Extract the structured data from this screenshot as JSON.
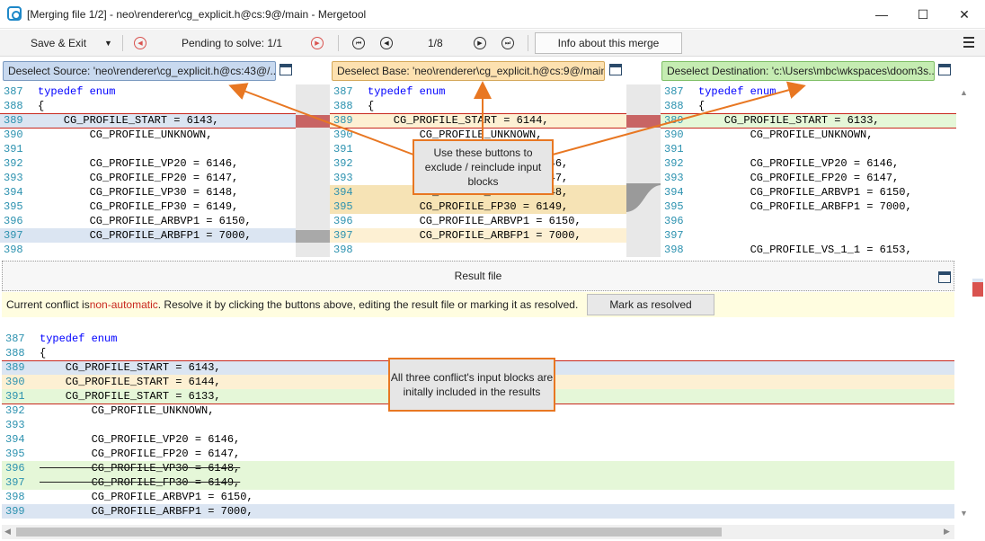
{
  "window": {
    "title": "[Merging file 1/2] - neo\\renderer\\cg_explicit.h@cs:9@/main - Mergetool",
    "minimize": "—",
    "maximize": "☐",
    "close": "✕"
  },
  "toolbar": {
    "save_exit": "Save & Exit",
    "pending": "Pending to solve: 1/1",
    "position": "1/8",
    "info": "Info about this merge"
  },
  "panes": {
    "source": {
      "label": "Deselect Source: 'neo\\renderer\\cg_explicit.h@cs:43@/...",
      "color": "#c8d9ef"
    },
    "base": {
      "label": "Deselect Base: 'neo\\renderer\\cg_explicit.h@cs:9@/main'",
      "color": "#fde1b0"
    },
    "destination": {
      "label": "Deselect Destination: 'c:\\Users\\mbc\\wkspaces\\doom3s...",
      "color": "#c5ecb2"
    }
  },
  "source_lines": [
    {
      "n": "387",
      "t": "typedef enum",
      "kw": true
    },
    {
      "n": "388",
      "t": "{"
    },
    {
      "n": "389",
      "t": "    CG_PROFILE_START = 6143,",
      "hl": "blue"
    },
    {
      "n": "390",
      "t": "        CG_PROFILE_UNKNOWN,"
    },
    {
      "n": "391",
      "t": ""
    },
    {
      "n": "392",
      "t": "        CG_PROFILE_VP20 = 6146,"
    },
    {
      "n": "393",
      "t": "        CG_PROFILE_FP20 = 6147,"
    },
    {
      "n": "394",
      "t": "        CG_PROFILE_VP30 = 6148,"
    },
    {
      "n": "395",
      "t": "        CG_PROFILE_FP30 = 6149,"
    },
    {
      "n": "396",
      "t": "        CG_PROFILE_ARBVP1 = 6150,"
    },
    {
      "n": "397",
      "t": "        CG_PROFILE_ARBFP1 = 7000,",
      "hl": "blue"
    },
    {
      "n": "398",
      "t": ""
    }
  ],
  "base_lines": [
    {
      "n": "387",
      "t": "typedef enum",
      "kw": true
    },
    {
      "n": "388",
      "t": "{"
    },
    {
      "n": "389",
      "t": "    CG_PROFILE_START = 6144,",
      "hl": "orange"
    },
    {
      "n": "390",
      "t": "        CG_PROFILE_UNKNOWN,"
    },
    {
      "n": "391",
      "t": ""
    },
    {
      "n": "392",
      "t": "        CG_PROFILE_VP20 = 6146,"
    },
    {
      "n": "393",
      "t": "        CG_PROFILE_FP20 = 6147,"
    },
    {
      "n": "394",
      "t": "        CG_PROFILE_VP30 = 6148,",
      "hl": "orange2"
    },
    {
      "n": "395",
      "t": "        CG_PROFILE_FP30 = 6149,",
      "hl": "orange2"
    },
    {
      "n": "396",
      "t": "        CG_PROFILE_ARBVP1 = 6150,"
    },
    {
      "n": "397",
      "t": "        CG_PROFILE_ARBFP1 = 7000,",
      "hl": "orange"
    },
    {
      "n": "398",
      "t": ""
    }
  ],
  "dest_lines": [
    {
      "n": "387",
      "t": "typedef enum",
      "kw": true
    },
    {
      "n": "388",
      "t": "{"
    },
    {
      "n": "389",
      "t": "    CG_PROFILE_START = 6133,",
      "hl": "green"
    },
    {
      "n": "390",
      "t": "        CG_PROFILE_UNKNOWN,"
    },
    {
      "n": "391",
      "t": ""
    },
    {
      "n": "392",
      "t": "        CG_PROFILE_VP20 = 6146,"
    },
    {
      "n": "393",
      "t": "        CG_PROFILE_FP20 = 6147,"
    },
    {
      "n": "394",
      "t": "        CG_PROFILE_ARBVP1 = 6150,"
    },
    {
      "n": "395",
      "t": "        CG_PROFILE_ARBFP1 = 7000,"
    },
    {
      "n": "396",
      "t": ""
    },
    {
      "n": "397",
      "t": ""
    },
    {
      "n": "398",
      "t": "        CG_PROFILE_VS_1_1 = 6153,"
    }
  ],
  "result": {
    "header": "Result file",
    "conflict_prefix": "Current conflict is ",
    "conflict_status": "non-automatic",
    "conflict_suffix": ". Resolve it by clicking the buttons above, editing the result file or marking it as resolved.",
    "mark_resolved": "Mark as resolved"
  },
  "result_lines": [
    {
      "n": "",
      "t": ""
    },
    {
      "n": "387",
      "t": "typedef enum",
      "kw": true
    },
    {
      "n": "388",
      "t": "{"
    },
    {
      "n": "389",
      "t": "    CG_PROFILE_START = 6143,",
      "hl": "blue"
    },
    {
      "n": "390",
      "t": "    CG_PROFILE_START = 6144,",
      "hl": "orange"
    },
    {
      "n": "391",
      "t": "    CG_PROFILE_START = 6133,",
      "hl": "green"
    },
    {
      "n": "392",
      "t": "        CG_PROFILE_UNKNOWN,"
    },
    {
      "n": "393",
      "t": ""
    },
    {
      "n": "394",
      "t": "        CG_PROFILE_VP20 = 6146,"
    },
    {
      "n": "395",
      "t": "        CG_PROFILE_FP20 = 6147,"
    },
    {
      "n": "396",
      "t": "        CG_PROFILE_VP30 = 6148,",
      "hl": "green",
      "strike": true
    },
    {
      "n": "397",
      "t": "        CG_PROFILE_FP30 = 6149,",
      "hl": "green",
      "strike": true
    },
    {
      "n": "398",
      "t": "        CG_PROFILE_ARBVP1 = 6150,"
    },
    {
      "n": "399",
      "t": "        CG_PROFILE_ARBFP1 = 7000,",
      "hl": "blue"
    }
  ],
  "callouts": {
    "buttons": "Use these buttons to exclude / reinclude input blocks",
    "results": "All three conflict's input blocks are initally included in the results"
  },
  "colors": {
    "blue": "#dbe5f2",
    "orange": "#fdf0d3",
    "orange2": "#f6e3b5",
    "green": "#e5f7d8",
    "callout_border": "#e87722",
    "conflict_red": "#c8281e"
  }
}
